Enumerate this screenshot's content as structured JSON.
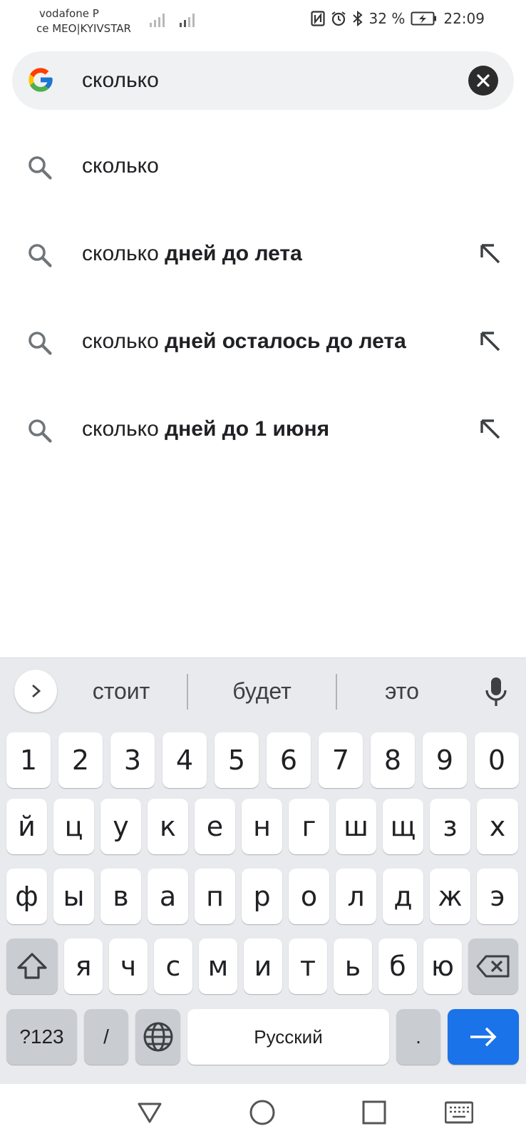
{
  "status_bar": {
    "carrier1": "vodafone P",
    "carrier2": "ce MEO|KYIVSTAR",
    "battery_percent": "32 %",
    "time": "22:09",
    "icons": [
      "nfc-icon",
      "alarm-icon",
      "bluetooth-icon",
      "battery-charging-icon"
    ]
  },
  "search": {
    "query": "сколько",
    "logo": "google-g-logo",
    "clear_icon": "close-icon"
  },
  "suggestions": [
    {
      "prefix": "сколько",
      "completion": "",
      "has_fill_arrow": false
    },
    {
      "prefix": "сколько ",
      "completion": "дней до лета",
      "has_fill_arrow": true
    },
    {
      "prefix": "сколько ",
      "completion": "дней осталось до лета",
      "has_fill_arrow": true
    },
    {
      "prefix": "сколько ",
      "completion": "дней до 1 июня",
      "has_fill_arrow": true
    }
  ],
  "keyboard": {
    "word_suggestions": [
      "стоит",
      "будет",
      "это"
    ],
    "number_row": [
      "1",
      "2",
      "3",
      "4",
      "5",
      "6",
      "7",
      "8",
      "9",
      "0"
    ],
    "row1": [
      "й",
      "ц",
      "у",
      "к",
      "е",
      "н",
      "г",
      "ш",
      "щ",
      "з",
      "х"
    ],
    "row2": [
      "ф",
      "ы",
      "в",
      "а",
      "п",
      "р",
      "о",
      "л",
      "д",
      "ж",
      "э"
    ],
    "row3": [
      "я",
      "ч",
      "с",
      "м",
      "и",
      "т",
      "ь",
      "б",
      "ю"
    ],
    "symbols_key": "?123",
    "slash_key": "/",
    "space_label": "Русский",
    "period_key": ".",
    "colors": {
      "enter": "#1a73e8",
      "key": "#ffffff",
      "func_key": "#c9ccd1",
      "background": "#e8eaed"
    }
  },
  "nav_bar": {
    "icons": [
      "back-icon",
      "home-icon",
      "recents-icon",
      "keyboard-switch-icon"
    ]
  }
}
